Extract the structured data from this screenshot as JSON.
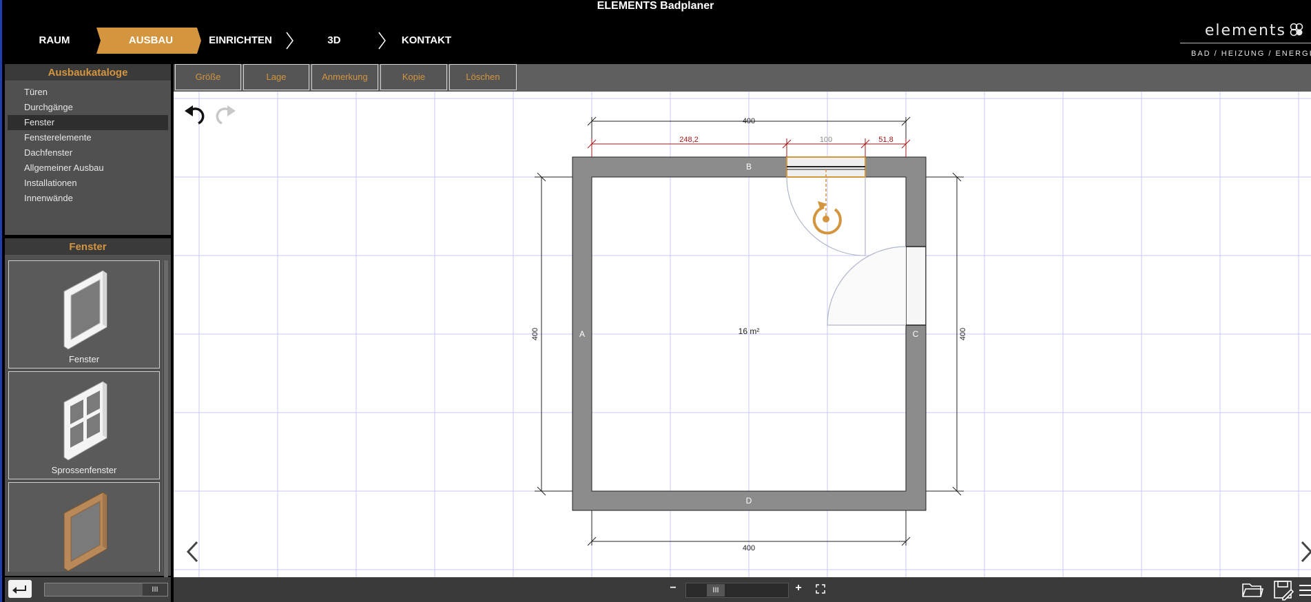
{
  "app": {
    "title": "ELEMENTS Badplaner"
  },
  "nav": {
    "items": [
      {
        "label": "RAUM"
      },
      {
        "label": "AUSBAU",
        "active": true
      },
      {
        "label": "EINRICHTEN"
      },
      {
        "label": "3D"
      },
      {
        "label": "KONTAKT"
      }
    ],
    "accent_color": "#d4953f"
  },
  "logo": {
    "word": "elements",
    "tagline": "BAD / HEIZUNG / ENERGIE"
  },
  "catalog": {
    "title": "Ausbaukataloge",
    "items": [
      {
        "label": "Türen"
      },
      {
        "label": "Durchgänge"
      },
      {
        "label": "Fenster",
        "selected": true
      },
      {
        "label": "Fensterelemente"
      },
      {
        "label": "Dachfenster"
      },
      {
        "label": "Allgemeiner Ausbau"
      },
      {
        "label": "Installationen"
      },
      {
        "label": "Innenwände"
      }
    ]
  },
  "fenster": {
    "title": "Fenster",
    "items": [
      {
        "label": "Fenster",
        "icon": "window-white-icon"
      },
      {
        "label": "Sprossenfenster",
        "icon": "window-mullion-icon"
      },
      {
        "label": "",
        "icon": "window-wood-icon"
      }
    ]
  },
  "toolbar": {
    "buttons": [
      {
        "label": "Größe"
      },
      {
        "label": "Lage"
      },
      {
        "label": "Anmerkung"
      },
      {
        "label": "Kopie"
      },
      {
        "label": "Löschen"
      }
    ]
  },
  "plan": {
    "area": "16 m²",
    "walls": {
      "a": "A",
      "b": "B",
      "c": "C",
      "d": "D"
    },
    "dims": {
      "top": "400",
      "bottom": "400",
      "left": "400",
      "right": "400",
      "seg1": "248,2",
      "seg2": "100",
      "seg3": "51,8"
    }
  },
  "bottom": {
    "zoom_minus": "−",
    "zoom_plus": "+",
    "grip": "III"
  }
}
